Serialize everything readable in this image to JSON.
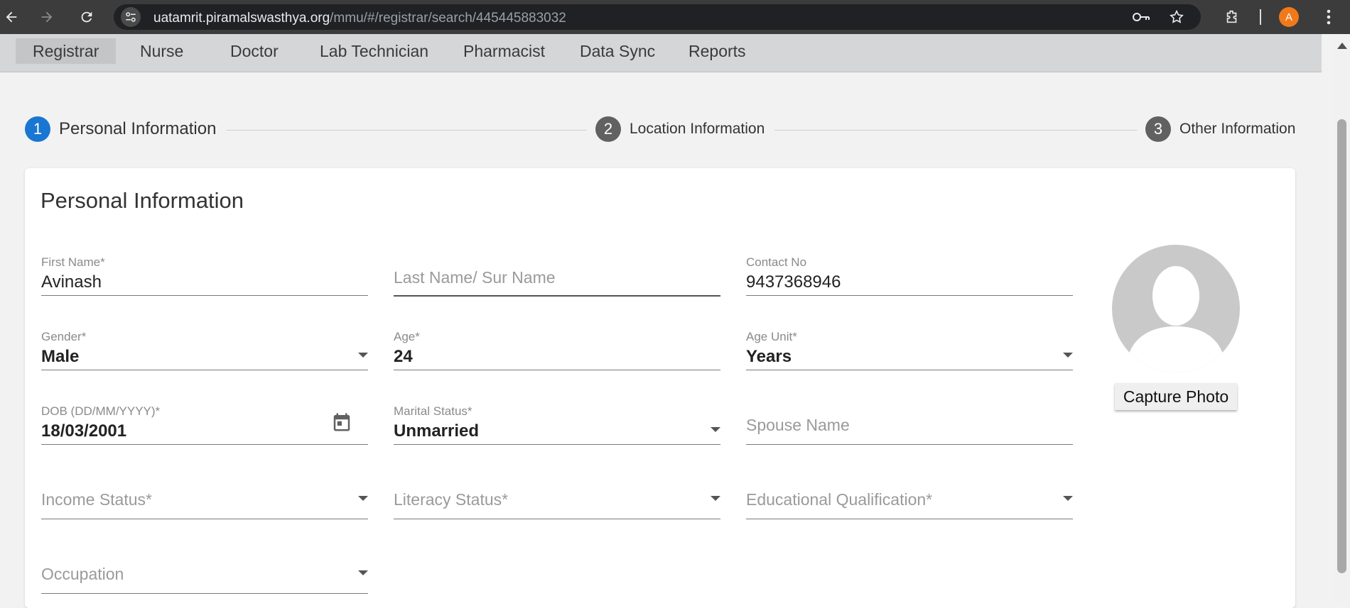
{
  "browser": {
    "url_host": "uatamrit.piramalswasthya.org",
    "url_path": "/mmu/#/registrar/search/445445883032",
    "profile_initial": "A"
  },
  "menu": {
    "items": [
      {
        "label": "Registrar",
        "active": true
      },
      {
        "label": "Nurse"
      },
      {
        "label": "Doctor"
      },
      {
        "label": "Lab Technician"
      },
      {
        "label": "Pharmacist"
      },
      {
        "label": "Data Sync"
      },
      {
        "label": "Reports"
      }
    ]
  },
  "stepper": {
    "steps": [
      {
        "number": "1",
        "label": "Personal Information",
        "active": true
      },
      {
        "number": "2",
        "label": "Location Information"
      },
      {
        "number": "3",
        "label": "Other Information"
      }
    ],
    "active_color": "#1976d2",
    "inactive_color": "#616161"
  },
  "form": {
    "title": "Personal Information",
    "first_name": {
      "label": "First Name*",
      "value": "Avinash"
    },
    "last_name": {
      "placeholder": "Last Name/ Sur Name"
    },
    "contact_no": {
      "label": "Contact No",
      "value": "9437368946"
    },
    "gender": {
      "label": "Gender*",
      "value": "Male"
    },
    "age": {
      "label": "Age*",
      "value": "24"
    },
    "age_unit": {
      "label": "Age Unit*",
      "value": "Years"
    },
    "dob": {
      "label": "DOB (DD/MM/YYYY)*",
      "value": "18/03/2001"
    },
    "marital_status": {
      "label": "Marital Status*",
      "value": "Unmarried"
    },
    "spouse_name": {
      "placeholder": "Spouse Name"
    },
    "income_status": {
      "placeholder": "Income Status*"
    },
    "literacy_status": {
      "placeholder": "Literacy Status*"
    },
    "educational_qualification": {
      "placeholder": "Educational Qualification*"
    },
    "occupation": {
      "placeholder": "Occupation"
    },
    "capture_photo_label": "Capture Photo"
  }
}
